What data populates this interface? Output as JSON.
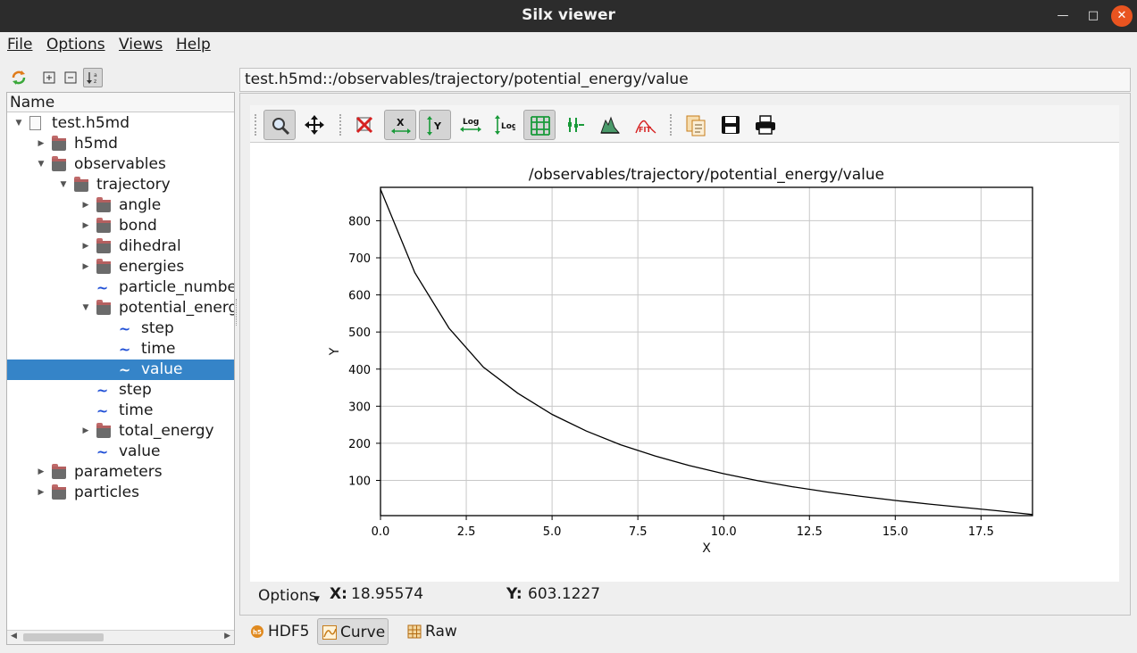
{
  "window": {
    "title": "Silx viewer"
  },
  "menubar": {
    "items": [
      {
        "label": "File"
      },
      {
        "label": "Options"
      },
      {
        "label": "Views"
      },
      {
        "label": "Help"
      }
    ]
  },
  "tree": {
    "header": "Name",
    "rows": [
      {
        "label": "test.h5md",
        "kind": "file",
        "expander": "expanded"
      },
      {
        "label": "h5md",
        "kind": "group",
        "expander": "collapsed"
      },
      {
        "label": "observables",
        "kind": "group",
        "expander": "expanded"
      },
      {
        "label": "trajectory",
        "kind": "group",
        "expander": "expanded"
      },
      {
        "label": "angle",
        "kind": "group",
        "expander": "collapsed"
      },
      {
        "label": "bond",
        "kind": "group",
        "expander": "collapsed"
      },
      {
        "label": "dihedral",
        "kind": "group",
        "expander": "collapsed"
      },
      {
        "label": "energies",
        "kind": "group",
        "expander": "collapsed"
      },
      {
        "label": "particle_numbe",
        "kind": "dataset",
        "expander": "none"
      },
      {
        "label": "potential_energ",
        "kind": "group",
        "expander": "expanded"
      },
      {
        "label": "step",
        "kind": "dataset",
        "expander": "none"
      },
      {
        "label": "time",
        "kind": "dataset",
        "expander": "none"
      },
      {
        "label": "value",
        "kind": "dataset",
        "expander": "none",
        "selected": true
      },
      {
        "label": "step",
        "kind": "dataset",
        "expander": "none"
      },
      {
        "label": "time",
        "kind": "dataset",
        "expander": "none"
      },
      {
        "label": "total_energy",
        "kind": "group",
        "expander": "collapsed"
      },
      {
        "label": "value",
        "kind": "dataset",
        "expander": "none"
      },
      {
        "label": "parameters",
        "kind": "group",
        "expander": "collapsed"
      },
      {
        "label": "particles",
        "kind": "group",
        "expander": "collapsed"
      }
    ]
  },
  "path": "test.h5md::/observables/trajectory/potential_energy/value",
  "plot_toolbar": {
    "icons": [
      "zoom-icon",
      "pan-icon",
      "reset-zoom-icon",
      "autoscale-x-icon",
      "autoscale-y-icon",
      "log-x-icon",
      "log-y-icon",
      "grid-icon",
      "curve-style-icon",
      "histogram-icon",
      "fit-icon",
      "copy-icon",
      "save-icon",
      "print-icon"
    ],
    "log_text": "Log",
    "fit_text": "FIT",
    "x_text": "X",
    "y_text": "Y"
  },
  "chart_data": {
    "type": "line",
    "title": "/observables/trajectory/potential_energy/value",
    "xlabel": "X",
    "ylabel": "Y",
    "xlim": [
      0,
      19
    ],
    "ylim": [
      5,
      890
    ],
    "grid": true,
    "xticks": [
      "0.0",
      "2.5",
      "5.0",
      "7.5",
      "10.0",
      "12.5",
      "15.0",
      "17.5"
    ],
    "yticks": [
      "100",
      "200",
      "300",
      "400",
      "500",
      "600",
      "700",
      "800"
    ],
    "x": [
      0,
      1,
      2,
      3,
      4,
      5,
      6,
      7,
      8,
      9,
      10,
      11,
      12,
      13,
      14,
      15,
      16,
      17,
      18,
      19
    ],
    "values": [
      885,
      660,
      510,
      405,
      335,
      278,
      233,
      196,
      166,
      140,
      118,
      99,
      83,
      69,
      57,
      46,
      36,
      27,
      18,
      8
    ]
  },
  "status": {
    "options_label": "Options",
    "x_label": "X:",
    "x_value": "18.95574",
    "y_label": "Y:",
    "y_value": "603.1227"
  },
  "view_tabs": [
    {
      "label": "HDF5",
      "active": false
    },
    {
      "label": "Curve",
      "active": true
    },
    {
      "label": "Raw",
      "active": false
    }
  ],
  "colors": {
    "titlebar": "#2c2c2c",
    "selection": "#3584c8",
    "close_button": "#e95420",
    "dataset_icon": "#1f4fd6"
  }
}
